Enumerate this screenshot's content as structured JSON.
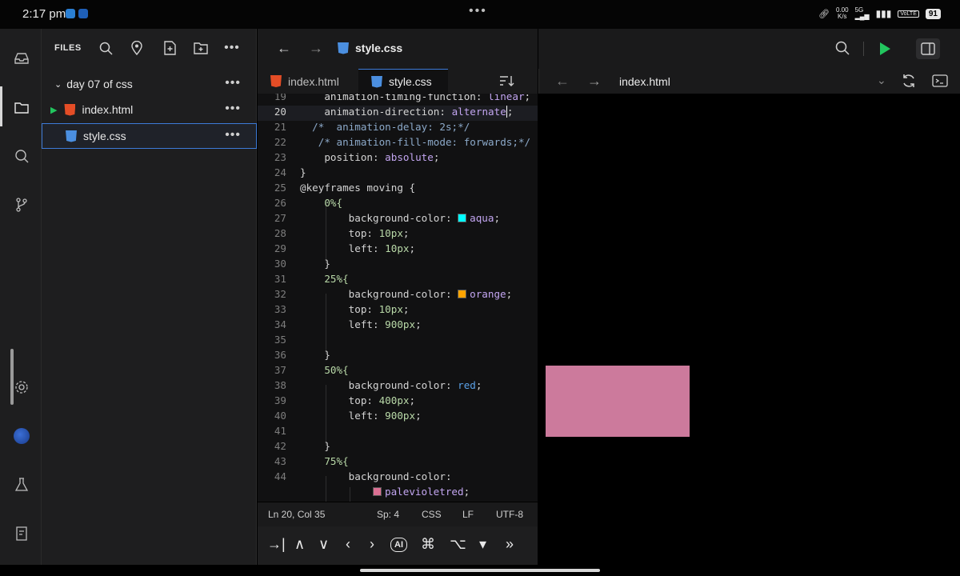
{
  "status": {
    "time": "2:17 pm",
    "network_speed": "0.00",
    "network_unit": "K/s",
    "signal": "5G",
    "volte": "VoLTE",
    "battery": "91"
  },
  "explorer": {
    "title": "FILES",
    "folder": "day 07 of css",
    "files": [
      {
        "name": "index.html",
        "type": "html"
      },
      {
        "name": "style.css",
        "type": "css"
      }
    ]
  },
  "editor": {
    "current_file": "style.css",
    "tabs": [
      {
        "label": "index.html",
        "type": "html"
      },
      {
        "label": "style.css",
        "type": "css"
      }
    ],
    "lines": [
      {
        "n": "19",
        "text": "    animation-timing-function: linear;"
      },
      {
        "n": "20",
        "text": "    animation-direction: alternate;"
      },
      {
        "n": "21",
        "text": "  /*  animation-delay: 2s;*/"
      },
      {
        "n": "22",
        "text": "   /* animation-fill-mode: forwards;*/"
      },
      {
        "n": "23",
        "text": "    position: absolute;"
      },
      {
        "n": "24",
        "text": "}"
      },
      {
        "n": "25",
        "text": "@keyframes moving {"
      },
      {
        "n": "26",
        "text": "    0%{"
      },
      {
        "n": "27",
        "text": "        background-color: aqua;"
      },
      {
        "n": "28",
        "text": "        top: 10px;"
      },
      {
        "n": "29",
        "text": "        left: 10px;"
      },
      {
        "n": "30",
        "text": "    }"
      },
      {
        "n": "31",
        "text": "    25%{"
      },
      {
        "n": "32",
        "text": "        background-color: orange;"
      },
      {
        "n": "33",
        "text": "        top: 10px;"
      },
      {
        "n": "34",
        "text": "        left: 900px;"
      },
      {
        "n": "35",
        "text": ""
      },
      {
        "n": "36",
        "text": "    }"
      },
      {
        "n": "37",
        "text": "    50%{"
      },
      {
        "n": "38",
        "text": "        background-color: red;"
      },
      {
        "n": "39",
        "text": "        top: 400px;"
      },
      {
        "n": "40",
        "text": "        left: 900px;"
      },
      {
        "n": "41",
        "text": ""
      },
      {
        "n": "42",
        "text": "    }"
      },
      {
        "n": "43",
        "text": "    75%{"
      },
      {
        "n": "44",
        "text": "        background-color:"
      },
      {
        "n": "",
        "text": "            palevioletred;"
      }
    ],
    "status": {
      "position": "Ln 20, Col 35",
      "spaces": "Sp: 4",
      "language": "CSS",
      "line_ending": "LF",
      "encoding": "UTF-8"
    },
    "keys": [
      "→|",
      "∧",
      "∨",
      "‹",
      "›",
      "AI",
      "⌘",
      "⌥",
      "▾",
      "»"
    ]
  },
  "preview": {
    "url": "index.html",
    "box_color": "#cc7a9c"
  },
  "colors": {
    "accent": "#3d7bd8",
    "run": "#22c55e",
    "aqua": "#00ffff",
    "orange": "#ffa500",
    "palevioletred": "#db7093"
  }
}
